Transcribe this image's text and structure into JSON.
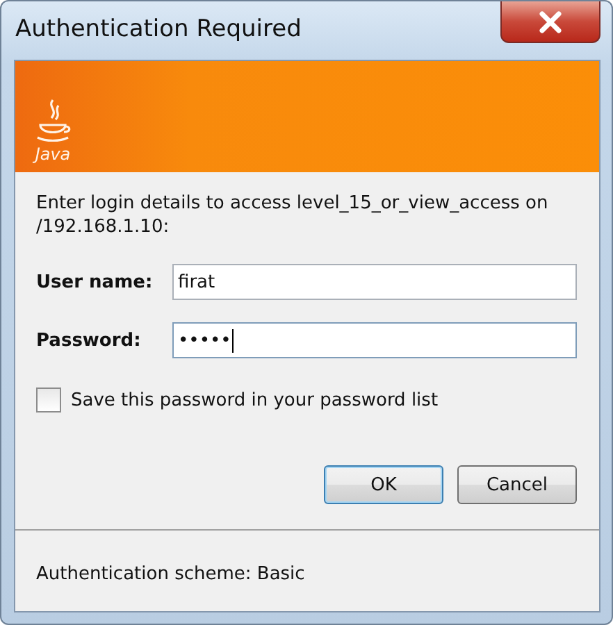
{
  "window": {
    "title": "Authentication Required"
  },
  "banner": {
    "logo_text": "Java"
  },
  "message": "Enter login details to access level_15_or_view_access on /192.168.1.10:",
  "fields": [
    {
      "label": "User name:",
      "value": "firat",
      "focused": false
    },
    {
      "label": "Password:",
      "value": "•••••",
      "focused": true
    }
  ],
  "save_password": {
    "label": "Save this password in your password list",
    "checked": false
  },
  "buttons": [
    {
      "label": "OK",
      "default": true
    },
    {
      "label": "Cancel",
      "default": false
    }
  ],
  "status": "Authentication scheme: Basic"
}
